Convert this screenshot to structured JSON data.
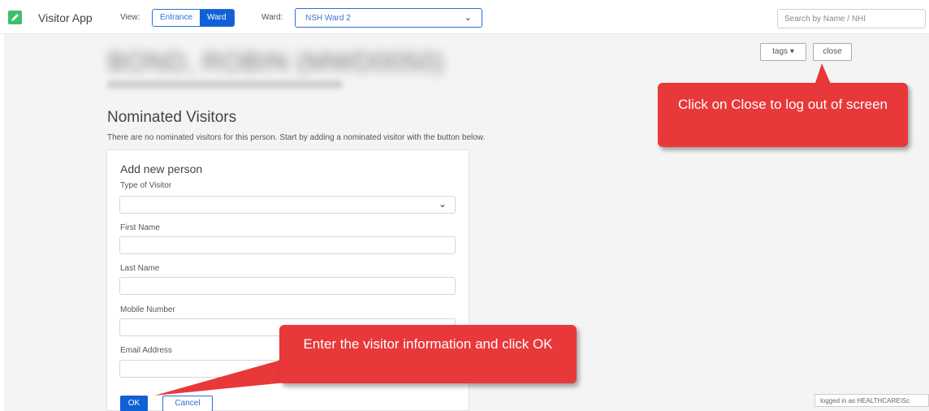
{
  "header": {
    "app_title": "Visitor App",
    "view_label": "View:",
    "view_options": [
      "Entrance",
      "Ward"
    ],
    "view_selected": "Ward",
    "ward_label": "Ward:",
    "ward_value": "NSH Ward 2",
    "search_placeholder": "Search by Name / NHI"
  },
  "patient": {
    "name": "BOND, ROBIN (MWD0050)"
  },
  "actions": {
    "tags_label": "tags ▾",
    "close_label": "close"
  },
  "nominated": {
    "title": "Nominated Visitors",
    "description": "There are no nominated visitors for this person. Start by adding a nominated visitor with the button below."
  },
  "form": {
    "title": "Add new person",
    "fields": [
      {
        "label": "Type of Visitor",
        "value": ""
      },
      {
        "label": "First Name",
        "value": ""
      },
      {
        "label": "Last Name",
        "value": ""
      },
      {
        "label": "Mobile Number",
        "value": ""
      },
      {
        "label": "Email Address",
        "value": ""
      }
    ],
    "ok_label": "OK",
    "cancel_label": "Cancel"
  },
  "footer": {
    "logged_in": "logged in as HEALTHCARE\\Sc"
  },
  "callouts": {
    "close_hint": "Click on Close to log out of screen",
    "enter_hint": "Enter the visitor information and click OK"
  },
  "colors": {
    "primary": "#1060d6",
    "callout": "#e8383a",
    "logo": "#3fbf6b"
  },
  "icons": {
    "logo": "pencil-edit-icon",
    "dropdown": "chevron-down-icon"
  }
}
